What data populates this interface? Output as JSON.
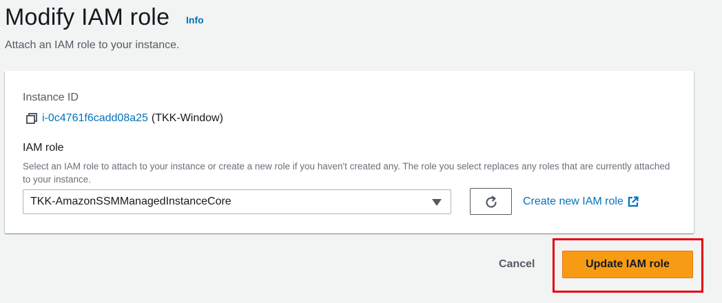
{
  "header": {
    "title": "Modify IAM role",
    "info_label": "Info",
    "description": "Attach an IAM role to your instance."
  },
  "instance": {
    "label": "Instance ID",
    "id": "i-0c4761f6cadd08a25",
    "name": "(TKK-Window)",
    "copy_icon": "copy-icon"
  },
  "iam_role": {
    "label": "IAM role",
    "description": "Select an IAM role to attach to your instance or create a new role if you haven't created any. The role you select replaces any roles that are currently attached to your instance.",
    "selected_value": "TKK-AmazonSSMManagedInstanceCore",
    "refresh_icon": "refresh-icon",
    "create_link": "Create new IAM role",
    "external_icon": "external-link-icon"
  },
  "actions": {
    "cancel_label": "Cancel",
    "submit_label": "Update IAM role"
  },
  "colors": {
    "background": "#f2f3f3",
    "link": "#0073bb",
    "primary": "#f89b14",
    "highlight": "#e3000f"
  }
}
